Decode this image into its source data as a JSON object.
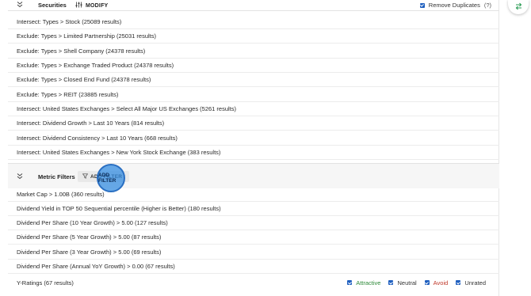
{
  "securities": {
    "title": "Securities",
    "modify_label": "MODIFY",
    "remove_duplicates_label": "Remove Duplicates",
    "remove_duplicates_checked": true,
    "help_label": "(?)",
    "rows": [
      "Intersect: Types > Stock (25089 results)",
      "Exclude: Types > Limited Partnership (25031 results)",
      "Exclude: Types > Shell Company (24378 results)",
      "Exclude: Types > Exchange Traded Product (24378 results)",
      "Exclude: Types > Closed End Fund (24378 results)",
      "Exclude: Types > REIT (23885 results)",
      "Intersect: United States Exchanges > Select All Major US Exchanges (5261 results)",
      "Intersect: Dividend Growth > Last 10 Years (814 results)",
      "Intersect: Dividend Consistency > Last 10 Years (668 results)",
      "Intersect: United States Exchanges > New York Stock Exchange (383 results)"
    ]
  },
  "metric_filters": {
    "title": "Metric Filters",
    "add_filter_label": "ADD FILTER",
    "rows": [
      "Market Cap > 1.00B (360 results)",
      "Dividend Yield in TOP 50 Sequential percentile (Higher is Better) (180 results)",
      "Dividend Per Share (10 Year Growth) > 5.00 (127 results)",
      "Dividend Per Share (5 Year Growth) > 5.00 (87 results)",
      "Dividend Per Share (3 Year Growth) > 5.00 (69 results)",
      "Dividend Per Share (Annual YoY Growth) > 0.00 (67 results)"
    ],
    "ratings_row": {
      "label": "Y-Ratings (67 results)",
      "options": [
        {
          "label": "Attractive",
          "checked": true,
          "color": "#2f8a3a"
        },
        {
          "label": "Neutral",
          "checked": true,
          "color": "#333333"
        },
        {
          "label": "Avoid",
          "checked": true,
          "color": "#c0392b"
        },
        {
          "label": "Unrated",
          "checked": true,
          "color": "#333333"
        }
      ]
    }
  },
  "colors": {
    "accent": "#1f5fbf",
    "click_highlight": "#348ce0",
    "fab_icon": "#2e9e57"
  }
}
